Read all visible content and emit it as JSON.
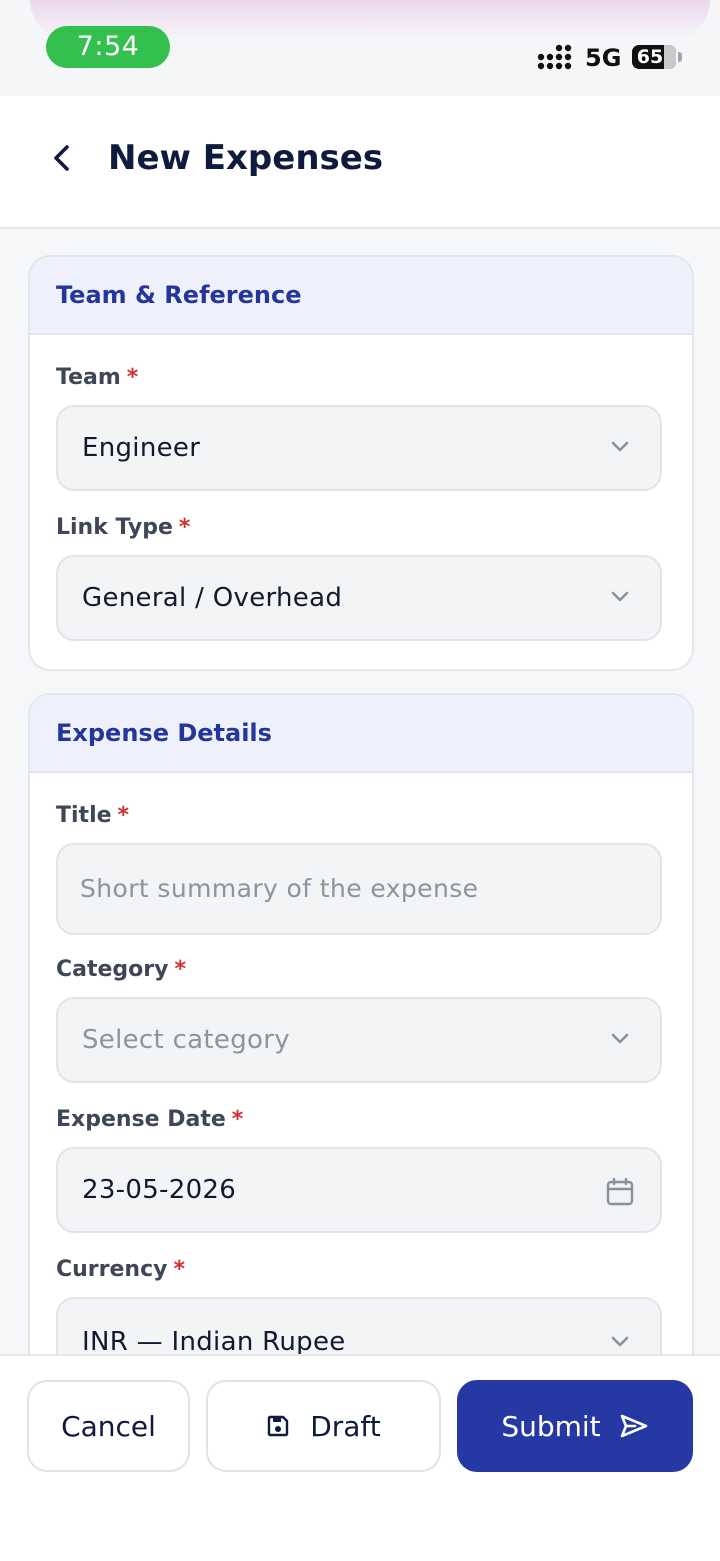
{
  "status_bar": {
    "time": "7:54",
    "network": "5G",
    "battery": "65"
  },
  "header": {
    "title": "New Expenses"
  },
  "sections": {
    "team_reference": {
      "title": "Team & Reference",
      "team": {
        "label": "Team",
        "required": "*",
        "value": "Engineer"
      },
      "link_type": {
        "label": "Link Type",
        "required": "*",
        "value": "General / Overhead"
      }
    },
    "expense_details": {
      "title": "Expense Details",
      "title_field": {
        "label": "Title",
        "required": "*",
        "placeholder": "Short summary of the expense"
      },
      "category": {
        "label": "Category",
        "required": "*",
        "placeholder": "Select category"
      },
      "expense_date": {
        "label": "Expense Date",
        "required": "*",
        "value": "23-05-2026"
      },
      "currency": {
        "label": "Currency",
        "required": "*",
        "value": "INR — Indian Rupee"
      }
    }
  },
  "actions": {
    "cancel": "Cancel",
    "draft": "Draft",
    "submit": "Submit"
  },
  "colors": {
    "primary": "#2538a3",
    "section_header_bg": "#eef0fc",
    "required": "#d32f2f",
    "status_time_pill": "#34c04f"
  },
  "icons": {
    "back": "chevron-left-icon",
    "dropdown": "chevron-down-icon",
    "date": "calendar-icon",
    "draft": "floppy-disk-icon",
    "submit": "send-icon"
  }
}
